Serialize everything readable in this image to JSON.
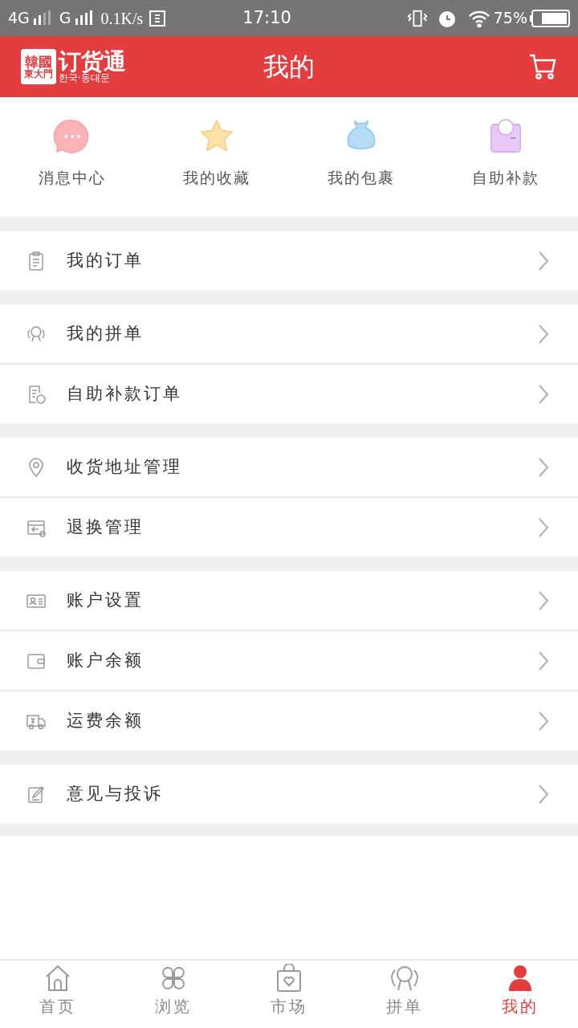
{
  "status_bar": {
    "network_1": "4G",
    "network_2": "G",
    "speed": "0.1K/s",
    "time": "17:10",
    "battery": "75%"
  },
  "header": {
    "logo": {
      "top": "韓國",
      "bottom": "東大門",
      "name": "订货通",
      "subtitle": "한국·동대문"
    },
    "title": "我的"
  },
  "quick_links": [
    {
      "label": "消息中心"
    },
    {
      "label": "我的收藏"
    },
    {
      "label": "我的包裹"
    },
    {
      "label": "自助补款"
    }
  ],
  "menu_groups": [
    {
      "items": [
        {
          "label": "我的订单"
        }
      ]
    },
    {
      "items": [
        {
          "label": "我的拼单"
        },
        {
          "label": "自助补款订单"
        }
      ]
    },
    {
      "items": [
        {
          "label": "收货地址管理"
        },
        {
          "label": "退换管理"
        }
      ]
    },
    {
      "items": [
        {
          "label": "账户设置"
        },
        {
          "label": "账户余额"
        },
        {
          "label": "运费余额"
        }
      ]
    },
    {
      "items": [
        {
          "label": "意见与投诉"
        }
      ]
    }
  ],
  "tab_bar": [
    {
      "label": "首页",
      "selected": false
    },
    {
      "label": "浏览",
      "selected": false
    },
    {
      "label": "市场",
      "selected": false
    },
    {
      "label": "拼单",
      "selected": false
    },
    {
      "label": "我的",
      "selected": true
    }
  ]
}
